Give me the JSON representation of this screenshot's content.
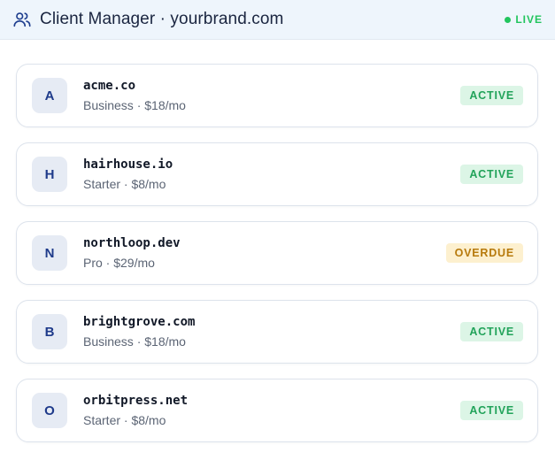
{
  "header": {
    "icon": "users-icon",
    "title": "Client Manager · yourbrand.com",
    "live_label": "LIVE",
    "live_color": "#22c55e"
  },
  "clients": [
    {
      "initial": "A",
      "domain": "acme.co",
      "plan": "Business · $18/mo",
      "status": "ACTIVE",
      "status_fg": "#22a35a",
      "status_bg": "#dcf5e6"
    },
    {
      "initial": "H",
      "domain": "hairhouse.io",
      "plan": "Starter · $8/mo",
      "status": "ACTIVE",
      "status_fg": "#22a35a",
      "status_bg": "#dcf5e6"
    },
    {
      "initial": "N",
      "domain": "northloop.dev",
      "plan": "Pro · $29/mo",
      "status": "OVERDUE",
      "status_fg": "#b77a0c",
      "status_bg": "#fdf0cf"
    },
    {
      "initial": "B",
      "domain": "brightgrove.com",
      "plan": "Business · $18/mo",
      "status": "ACTIVE",
      "status_fg": "#22a35a",
      "status_bg": "#dcf5e6"
    },
    {
      "initial": "O",
      "domain": "orbitpress.net",
      "plan": "Starter · $8/mo",
      "status": "ACTIVE",
      "status_fg": "#22a35a",
      "status_bg": "#dcf5e6"
    }
  ]
}
